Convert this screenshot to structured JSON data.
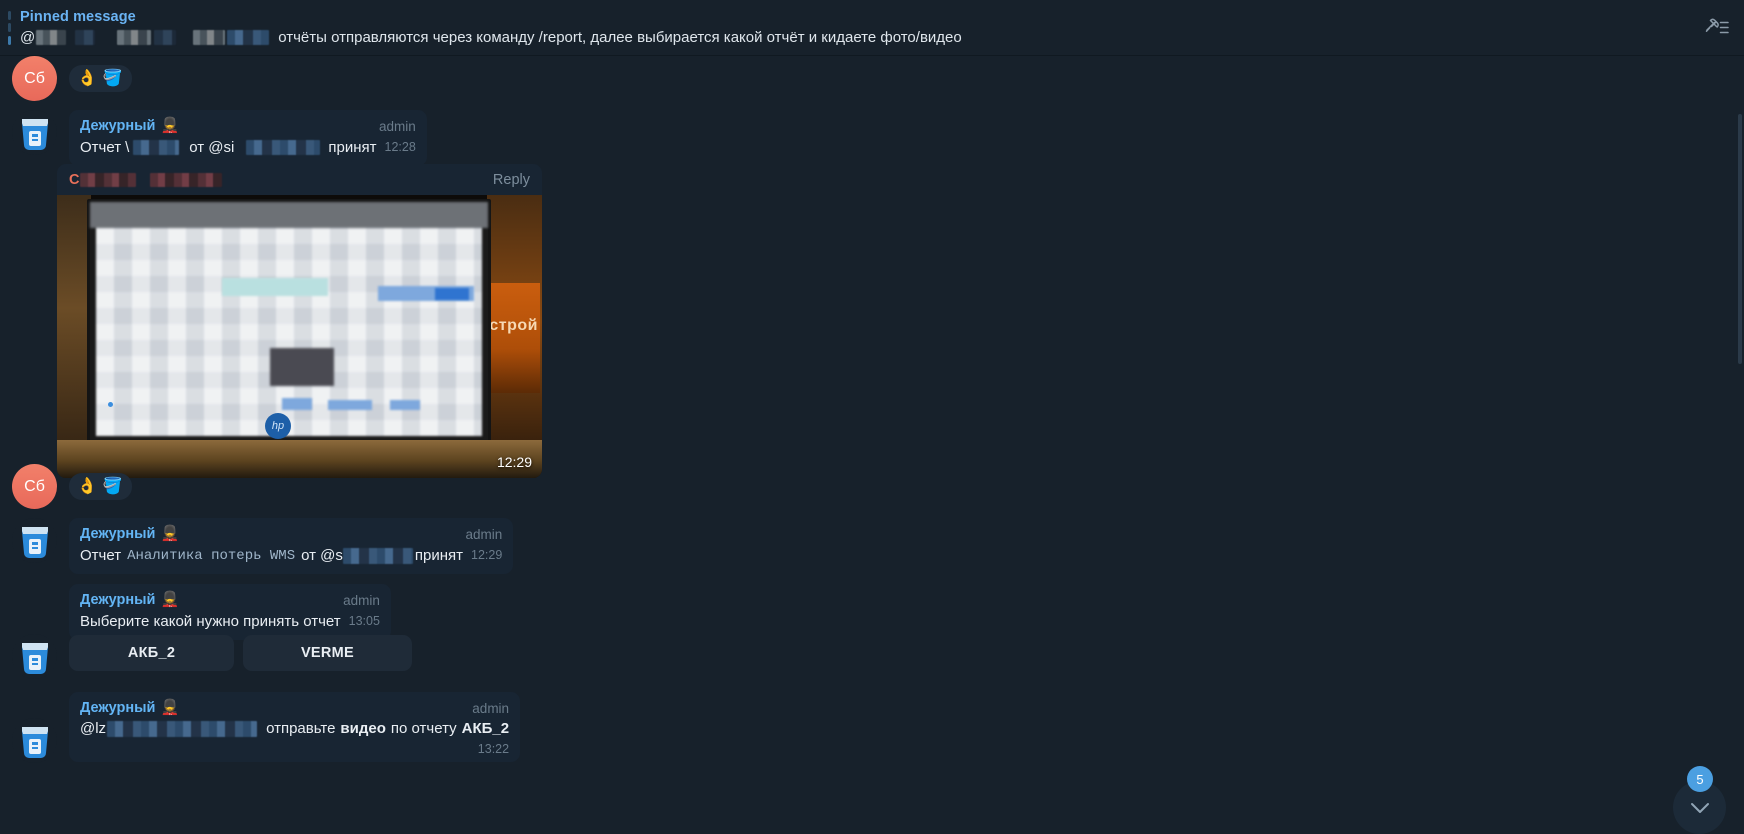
{
  "app": {
    "title": "Telegram Chat"
  },
  "pinned": {
    "label": "Pinned message",
    "redacted_user_prefix": "@",
    "text": "отчёты отправляются через команду /report, далее выбирается какой отчёт и кидаете фото/видео",
    "pin_list_icon": "pin-list-icon"
  },
  "messages": [
    {
      "id": "m1",
      "avatar": {
        "initials": "Сб",
        "color": "#ef7a63"
      },
      "reactions": [
        {
          "icon": "ok-hand-emoji",
          "glyph": "👌"
        },
        {
          "icon": "bot-badge-emoji",
          "glyph": "🪣"
        }
      ]
    },
    {
      "id": "m2",
      "sender": "Дежурный",
      "sender_emoji": "💂",
      "badge": "admin",
      "text_prefix": "Отчет",
      "text_mid": "от @si",
      "text_suffix": "принят",
      "time": "12:28",
      "avatar_icon": "bot-avatar-icon"
    },
    {
      "id": "m3",
      "reply_initial": "С",
      "reply_label": "Reply",
      "photo_time": "12:29",
      "photo_alt": "photo-monitor-screenshot",
      "screen_word": "строй"
    },
    {
      "id": "m4",
      "avatar": {
        "initials": "Сб",
        "color": "#ef7a63"
      },
      "reactions": [
        {
          "icon": "ok-hand-emoji",
          "glyph": "👌"
        },
        {
          "icon": "bot-badge-emoji",
          "glyph": "🪣"
        }
      ]
    },
    {
      "id": "m5",
      "sender": "Дежурный",
      "sender_emoji": "💂",
      "badge": "admin",
      "text_prefix": "Отчет",
      "report_name": "Аналитика  потерь  WMS",
      "text_mid": "от @s",
      "text_suffix": "принят",
      "time": "12:29",
      "avatar_icon": "bot-avatar-icon"
    },
    {
      "id": "m6",
      "sender": "Дежурный",
      "sender_emoji": "💂",
      "badge": "admin",
      "text": "Выберите какой нужно принять отчет",
      "time": "13:05",
      "buttons": [
        {
          "label": "АКБ_2"
        },
        {
          "label": "VERME"
        }
      ],
      "avatar_icon": "bot-avatar-icon"
    },
    {
      "id": "m7",
      "sender": "Дежурный",
      "sender_emoji": "💂",
      "badge": "admin",
      "mention": "@lz",
      "text_a": "отправьте",
      "text_bold1": "видео",
      "text_b": "по отчету",
      "text_bold2": "АКБ_2",
      "time": "13:22",
      "avatar_icon": "bot-avatar-icon"
    }
  ],
  "footer": {
    "unread_count": "5",
    "scroll_down_icon": "chevron-down-icon"
  },
  "colors": {
    "background": "#17212b",
    "bubble": "#182533",
    "accent": "#63b5f5",
    "badge": "#4b9fe1",
    "avatar_peach": "#ef7a63"
  }
}
